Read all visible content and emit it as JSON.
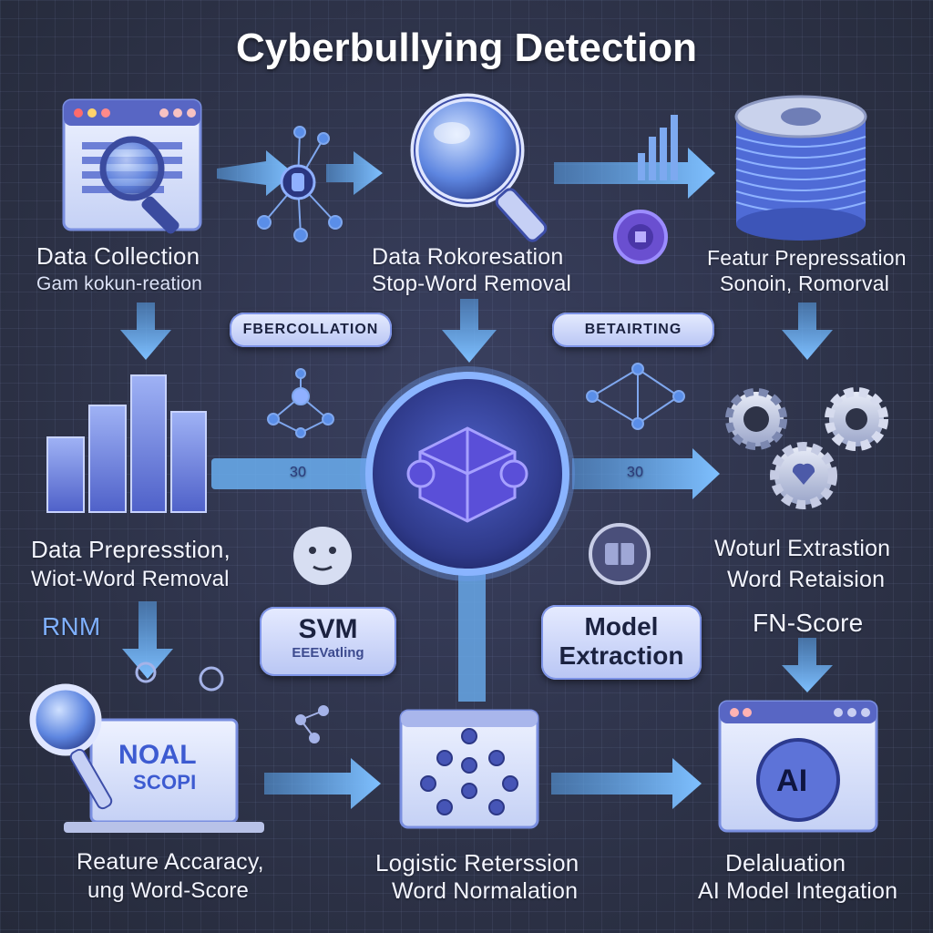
{
  "title": "Cyberbullying Detection",
  "colors": {
    "background": "#2e3347",
    "accent_blue": "#5aa4ee",
    "accent_purple": "#6c5ce7",
    "panel_light": "#dfe6ff"
  },
  "nodes": {
    "data_collection": {
      "title": "Data Collection",
      "subtitle": "Gam kokun-reation",
      "icon": "browser-magnifier-icon"
    },
    "data_processing": {
      "title": "Data Rokoresation",
      "subtitle": "Stop-Word Removal",
      "icon": "magnifying-glass-icon"
    },
    "feature_processing": {
      "title": "Featur Prepressation",
      "subtitle": "Sonoin, Romorval",
      "icon": "database-icon"
    },
    "data_prepression": {
      "title": "Data Prepresstion,",
      "subtitle": "Wiot-Word Removal",
      "icon": "bar-chart-icon"
    },
    "feature_extraction": {
      "title": "Woturl Extrastion",
      "subtitle": "Word Retaision",
      "extra": "FN-Score",
      "icon": "gears-icon"
    },
    "center_model": {
      "icon": "neural-core-icon"
    },
    "feature_accuracy": {
      "title": "Reature Accaracy,",
      "subtitle": "ung Word-Score",
      "screen_text": [
        "NOAL",
        "SCOPI"
      ],
      "icon": "laptop-magnifier-icon"
    },
    "logistic_regression": {
      "title": "Logistic Reterssion",
      "subtitle": "Word Normalation",
      "icon": "node-grid-icon"
    },
    "ai_integration": {
      "title": "Delaluation",
      "subtitle": "AI Model Integation",
      "screen_text": "AI",
      "icon": "ai-window-icon"
    }
  },
  "tags": {
    "svm": {
      "label": "SVM",
      "sublabel": "EEEVatling"
    },
    "model_extraction": {
      "label_line1": "Model",
      "label_line2": "Extraction"
    },
    "fbercollation": "FBERCOLLATION",
    "betairting": "BETAIRTING",
    "rnm": "RNM",
    "arrow_left_text": "30",
    "arrow_right_text": "30"
  }
}
